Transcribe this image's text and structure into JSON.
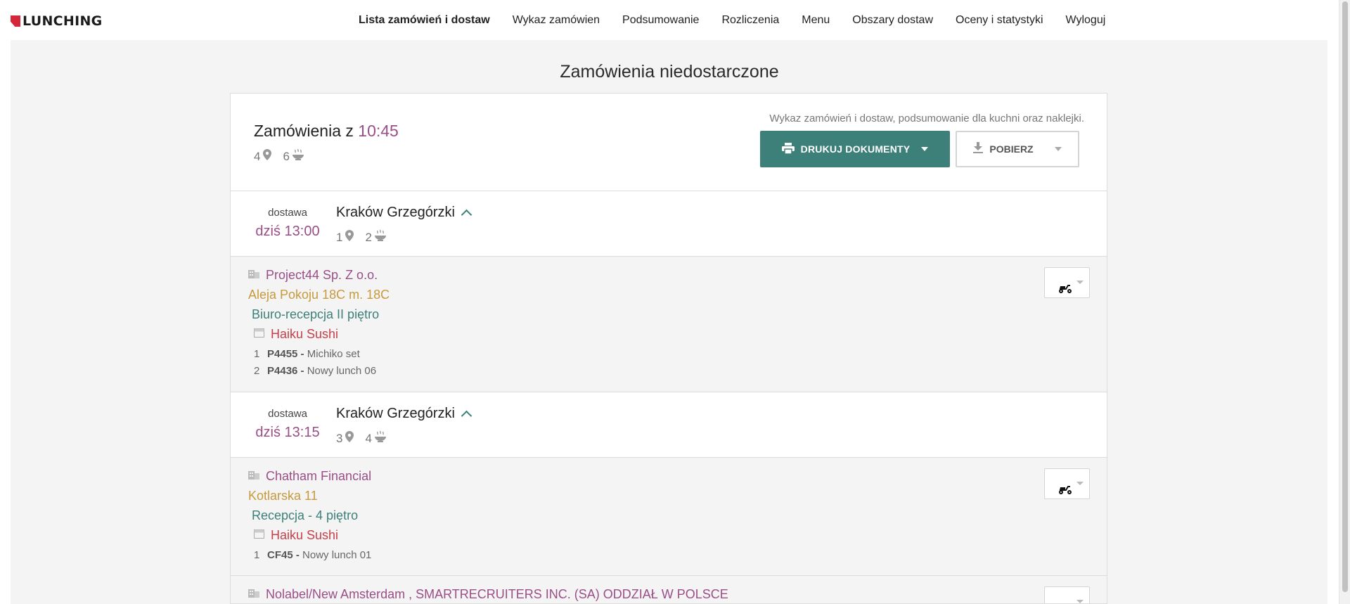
{
  "brand": {
    "name": "LUNCHING",
    "accent": "#d6263a"
  },
  "nav": {
    "items": [
      {
        "label": "Lista zamówień i dostaw",
        "active": true
      },
      {
        "label": "Wykaz zamówien"
      },
      {
        "label": "Podsumowanie"
      },
      {
        "label": "Rozliczenia"
      },
      {
        "label": "Menu"
      },
      {
        "label": "Obszary dostaw"
      },
      {
        "label": "Oceny i statystyki"
      },
      {
        "label": "Wyloguj"
      }
    ]
  },
  "page": {
    "title": "Zamówienia niedostarczone"
  },
  "batch": {
    "title_prefix": "Zamówienia z",
    "time": "10:45",
    "locations": "4",
    "meals": "6",
    "hint": "Wykaz zamówień i dostaw, podsumowanie dla kuchni oraz naklejki.",
    "print_label": "DRUKUJ DOKUMENTY",
    "download_label": "POBIERZ"
  },
  "deliveries": [
    {
      "label": "dostawa",
      "time": "dziś 13:00",
      "area": "Kraków Grzegórzki",
      "locations": "1",
      "meals": "2",
      "orders": [
        {
          "company": "Project44 Sp. Z o.o.",
          "address": "Aleja Pokoju 18C m. 18C",
          "room": "Biuro-recepcja II piętro",
          "restaurant": "Haiku Sushi",
          "items": [
            {
              "qty": "1",
              "code": "P4455 -",
              "name": "Michiko set"
            },
            {
              "qty": "2",
              "code": "P4436 -",
              "name": "Nowy lunch 06"
            }
          ]
        }
      ]
    },
    {
      "label": "dostawa",
      "time": "dziś 13:15",
      "area": "Kraków Grzegórzki",
      "locations": "3",
      "meals": "4",
      "orders": [
        {
          "company": "Chatham Financial",
          "address": "Kotlarska 11",
          "room": "Recepcja - 4 piętro",
          "restaurant": "Haiku Sushi",
          "items": [
            {
              "qty": "1",
              "code": "CF45 -",
              "name": "Nowy lunch 01"
            }
          ]
        },
        {
          "company": "Nolabel/New Amsterdam , SMARTRECRUITERS INC. (SA) ODDZIAŁ W POLSCE"
        }
      ]
    }
  ],
  "colors": {
    "primary_teal": "#3c8079",
    "plum": "#9a4e87",
    "gold": "#c79a3c",
    "red": "#c7404a"
  },
  "icons": [
    "map-pin-icon",
    "meal-bowl-icon",
    "printer-icon",
    "download-icon",
    "building-icon",
    "store-icon",
    "scooter-icon",
    "chevron-up-icon",
    "caret-down-icon"
  ]
}
